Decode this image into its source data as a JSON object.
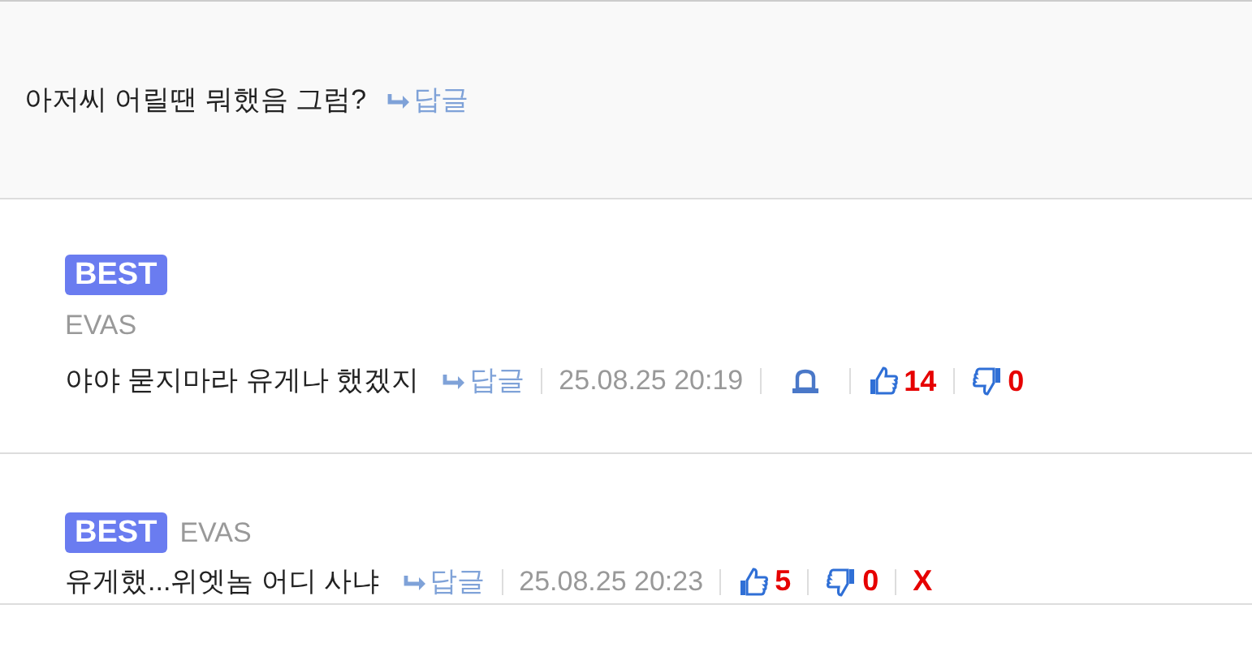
{
  "parent": {
    "text": "아저씨 어릴땐 뭐했음 그럼?",
    "reply_label": "답글"
  },
  "comments": [
    {
      "kind": "stacked",
      "badge": "BEST",
      "author": "EVAS",
      "text": "야야 묻지마라 유게나 했겠지",
      "reply_label": "답글",
      "time": "25.08.25 20:19",
      "report": true,
      "likes": "14",
      "dislikes": "0"
    },
    {
      "kind": "inline",
      "badge": "BEST",
      "author": "EVAS",
      "text": "유게했...위엣놈 어디 사냐",
      "reply_label": "답글",
      "time": "25.08.25 20:23",
      "report": false,
      "likes": "5",
      "dislikes": "0",
      "delete_label": "X"
    }
  ]
}
